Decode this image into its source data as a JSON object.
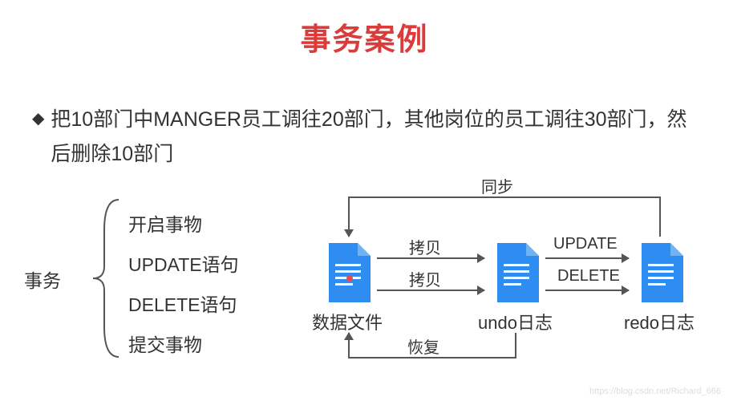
{
  "title": "事务案例",
  "description": "把10部门中MANGER员工调往20部门，其他岗位的员工调往30部门，然后删除10部门",
  "transaction_label": "事务",
  "steps": {
    "s1": "开启事物",
    "s2": "UPDATE语句",
    "s3": "DELETE语句",
    "s4": "提交事物"
  },
  "files": {
    "data_file": "数据文件",
    "undo_log": "undo日志",
    "redo_log": "redo日志"
  },
  "arrows": {
    "copy": "拷贝",
    "sync": "同步",
    "update": "UPDATE",
    "delete": "DELETE",
    "restore": "恢复"
  },
  "watermark": "https://blog.csdn.net/Richard_666"
}
